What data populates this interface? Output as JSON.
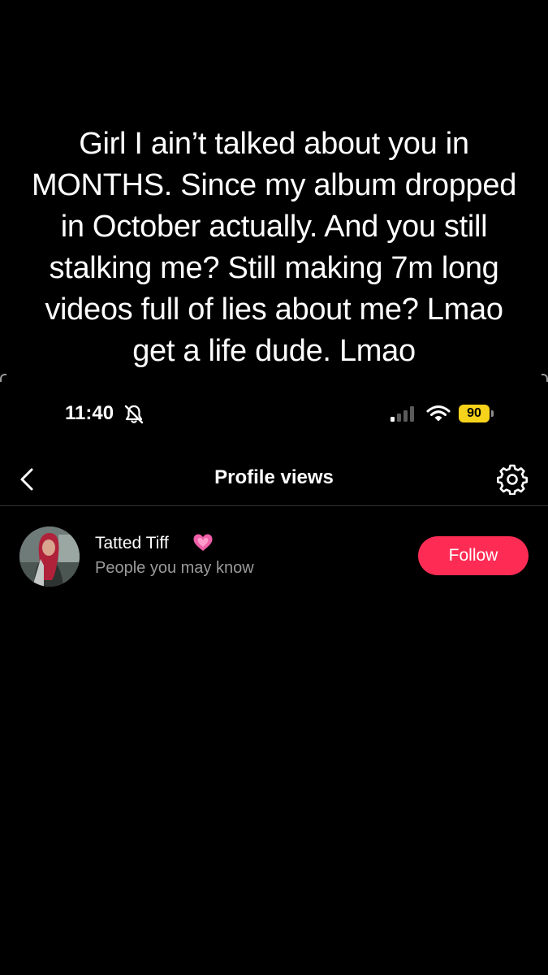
{
  "caption": {
    "text": "Girl I ain’t talked about you in MONTHS. Since my album dropped in October actually. And you still stalking me? Still making 7m long videos full of lies about me? Lmao get a life dude. Lmao"
  },
  "status_bar": {
    "time": "11:40",
    "silent_icon": "bell-off-icon",
    "signal_icon": "cellular-signal-icon",
    "wifi_icon": "wifi-icon",
    "battery_level": "90",
    "battery_color": "#f7d21a"
  },
  "header": {
    "back_icon": "chevron-left-icon",
    "title": "Profile views",
    "settings_icon": "gear-icon"
  },
  "profile_views": [
    {
      "name": "Tatted Tiff",
      "badge_icon": "pink-heart-icon",
      "subtitle": "People you may know",
      "follow_label": "Follow",
      "follow_color": "#fe2c55"
    }
  ]
}
